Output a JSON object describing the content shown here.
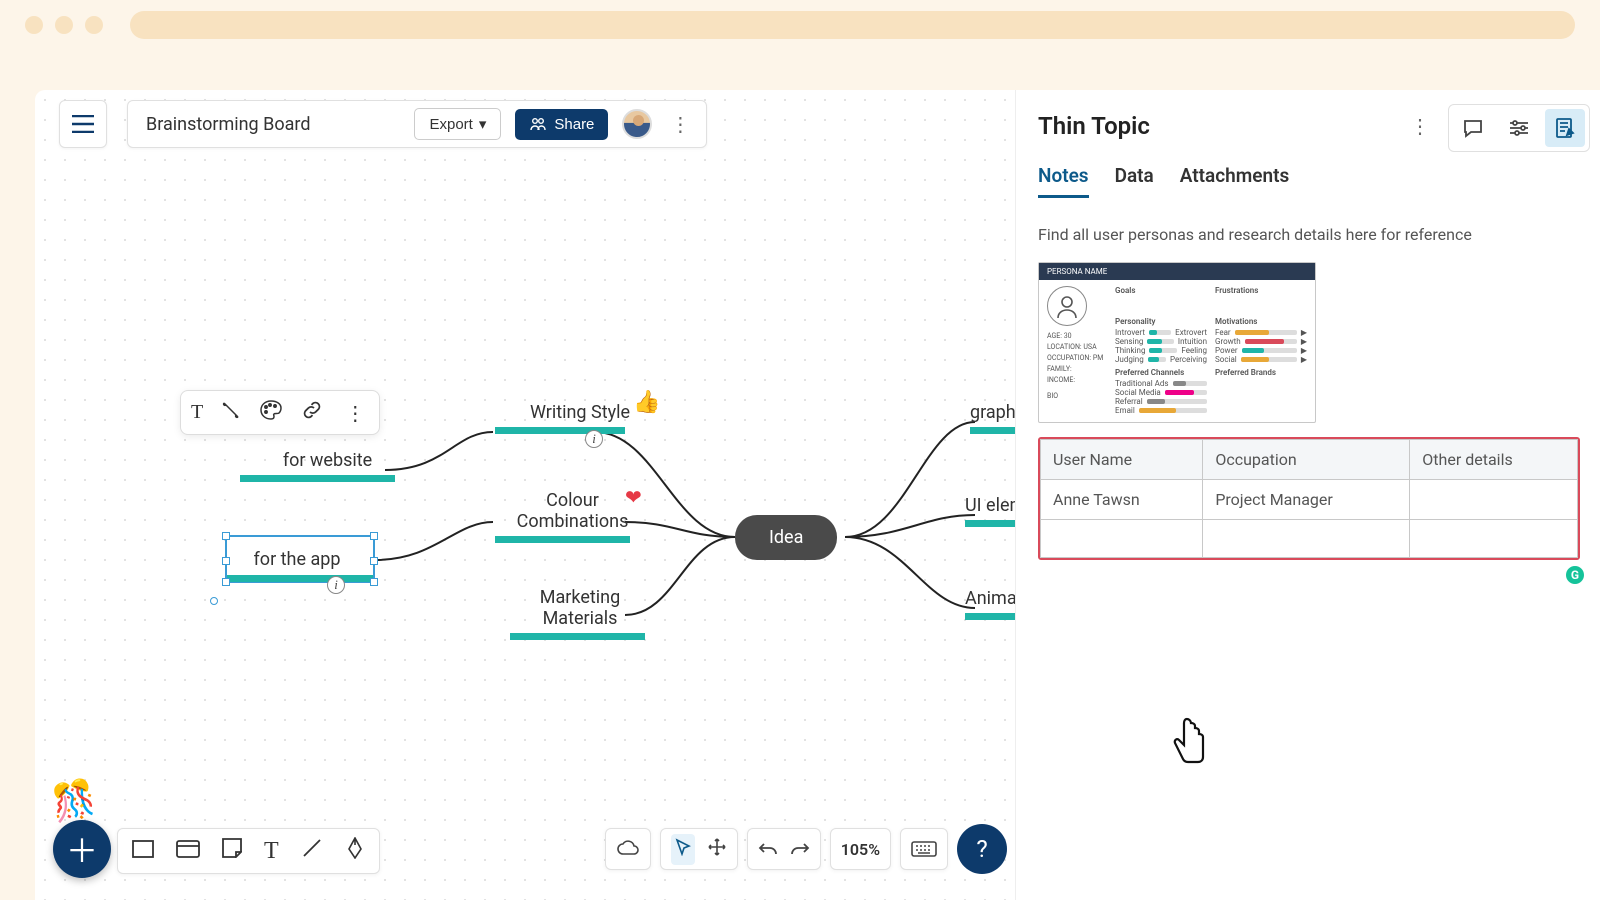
{
  "browser": {},
  "board": {
    "title": "Brainstorming Board",
    "export_label": "Export",
    "share_label": "Share"
  },
  "mindmap": {
    "central": "Idea",
    "left_nodes": {
      "writing_style": "Writing Style",
      "for_website": "for website",
      "for_the_app": "for the app",
      "colour_combinations_l1": "Colour",
      "colour_combinations_l2": "Combinations",
      "marketing_l1": "Marketing",
      "marketing_l2": "Materials"
    },
    "right_nodes": {
      "graphic": "graphic s",
      "ui_elements": "UI eleme",
      "animation": "Animatio"
    }
  },
  "bottom": {
    "zoom": "105%"
  },
  "panel": {
    "title": "Thin Topic",
    "tabs": {
      "notes": "Notes",
      "data": "Data",
      "attachments": "Attachments"
    },
    "notes_text": "Find all user personas and research details here for reference",
    "persona_header": "PERSONA NAME",
    "persona_labels": {
      "goals": "Goals",
      "frustrations": "Frustrations",
      "personality": "Personality",
      "motivations": "Motivations",
      "age": "AGE: 30",
      "location": "LOCATION: USA",
      "occupation": "OCCUPATION: PM",
      "family": "FAMILY:",
      "income": "INCOME:",
      "bio": "BIO",
      "channels": "Preferred Channels",
      "brands": "Preferred Brands",
      "introvert": "Introvert",
      "extrovert": "Extrovert",
      "sensing": "Sensing",
      "intuition": "Intuition",
      "thinking": "Thinking",
      "feeling": "Feeling",
      "judging": "Judging",
      "perceiving": "Perceiving",
      "fear": "Fear",
      "growth": "Growth",
      "power": "Power",
      "social": "Social",
      "traditional": "Traditional Ads",
      "socialmedia": "Social Media",
      "referral": "Referral",
      "email": "Email"
    },
    "table": {
      "headers": {
        "c1": "User Name",
        "c2": "Occupation",
        "c3": "Other details"
      },
      "rows": [
        {
          "c1": "Anne Tawsn",
          "c2": "Project Manager",
          "c3": ""
        },
        {
          "c1": "",
          "c2": "",
          "c3": ""
        }
      ]
    }
  }
}
